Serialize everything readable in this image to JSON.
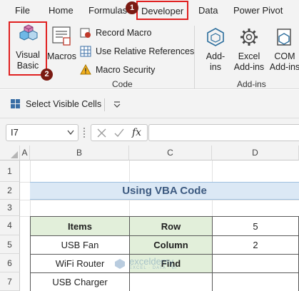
{
  "ribbon_tabs": [
    "File",
    "Home",
    "Formulas",
    "Developer",
    "Data",
    "Power Pivot"
  ],
  "callouts": {
    "step1": "1",
    "step2": "2"
  },
  "code_group": {
    "visual_basic_label_1": "Visual",
    "visual_basic_label_2": "Basic",
    "macros_label": "Macros",
    "record_macro": "Record Macro",
    "relative_refs": "Use Relative References",
    "macro_security": "Macro Security",
    "group_label": "Code"
  },
  "addins_group": {
    "addins_1": "Add-",
    "addins_2": "ins",
    "excel_addins_1": "Excel",
    "excel_addins_2": "Add-ins",
    "com_addins_1": "COM",
    "com_addins_2": "Add-ins",
    "group_label": "Add-ins"
  },
  "qat": {
    "select_visible_cells": "Select Visible Cells"
  },
  "formula_bar": {
    "name_box": "I7",
    "fx": "fx",
    "formula": ""
  },
  "columns": [
    "A",
    "B",
    "C",
    "D"
  ],
  "rows": [
    "1",
    "2",
    "3",
    "4",
    "5",
    "6",
    "7"
  ],
  "sheet": {
    "title": "Using VBA Code",
    "items_header": "Items",
    "items": [
      "USB Fan",
      "WiFi Router",
      "USB Charger"
    ],
    "labels": [
      "Row",
      "Column",
      "Find"
    ],
    "values": [
      "5",
      "2",
      ""
    ]
  },
  "watermark": {
    "name": "exceldemy",
    "tagline": "EXCEL · DATA · BI"
  },
  "colors": {
    "accent_red": "#e02020",
    "title_fill": "#dbe8f5",
    "header_fill": "#e2efda",
    "ribbon_bg": "#f3f3f3"
  }
}
